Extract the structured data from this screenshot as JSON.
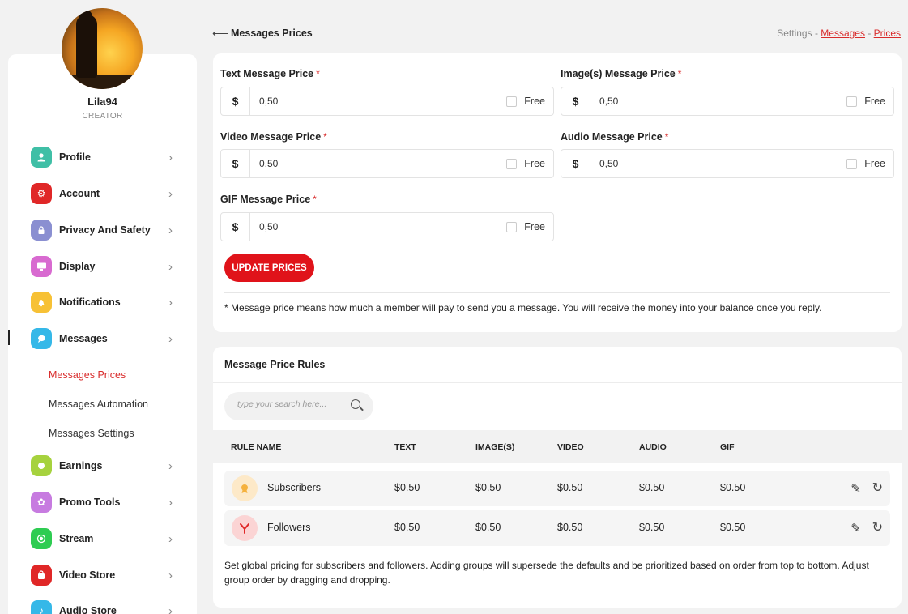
{
  "user": {
    "name": "Lila94",
    "role": "CREATOR"
  },
  "header": {
    "title": "Messages Prices",
    "breadcrumb": {
      "root": "Settings",
      "sep": " - ",
      "middle": "Messages",
      "current": "Prices"
    }
  },
  "sidebar": {
    "items": [
      {
        "label": "Profile",
        "color": "#3fbfa6",
        "icon": "person-icon"
      },
      {
        "label": "Account",
        "color": "#e02727",
        "icon": "gear-icon"
      },
      {
        "label": "Privacy And Safety",
        "color": "#8a8fd1",
        "icon": "lock-icon"
      },
      {
        "label": "Display",
        "color": "#d86ad0",
        "icon": "monitor-icon"
      },
      {
        "label": "Notifications",
        "color": "#f7c135",
        "icon": "bell-icon"
      },
      {
        "label": "Messages",
        "color": "#35b8e8",
        "icon": "chat-icon"
      },
      {
        "label": "Earnings",
        "color": "#a6d23e",
        "icon": "coin-icon"
      },
      {
        "label": "Promo Tools",
        "color": "#c77be0",
        "icon": "sparkle-icon"
      },
      {
        "label": "Stream",
        "color": "#2ecc52",
        "icon": "record-icon"
      },
      {
        "label": "Video Store",
        "color": "#e02727",
        "icon": "bag-icon"
      },
      {
        "label": "Audio Store",
        "color": "#35b8e8",
        "icon": "music-icon"
      }
    ],
    "subitems": [
      {
        "label": "Messages Prices"
      },
      {
        "label": "Messages Automation"
      },
      {
        "label": "Messages Settings"
      }
    ]
  },
  "prices": {
    "fields": [
      {
        "label": "Text Message Price",
        "currency": "$",
        "value": "0,50",
        "free_label": "Free"
      },
      {
        "label": "Image(s) Message Price",
        "currency": "$",
        "value": "0,50",
        "free_label": "Free"
      },
      {
        "label": "Video Message Price",
        "currency": "$",
        "value": "0,50",
        "free_label": "Free"
      },
      {
        "label": "Audio Message Price",
        "currency": "$",
        "value": "0,50",
        "free_label": "Free"
      },
      {
        "label": "GIF Message Price",
        "currency": "$",
        "value": "0,50",
        "free_label": "Free"
      }
    ],
    "required_mark": "*",
    "update_button": "UPDATE PRICES",
    "note": "* Message price means how much a member will pay to send you a message. You will receive the money into your balance once you reply."
  },
  "rules": {
    "title": "Message Price Rules",
    "search_placeholder": "type your search here...",
    "columns": [
      "RULE NAME",
      "TEXT",
      "IMAGE(S)",
      "VIDEO",
      "AUDIO",
      "GIF"
    ],
    "rows": [
      {
        "name": "Subscribers",
        "icon": "badge-icon",
        "icon_bg": "#fde9c8",
        "icon_color": "#f5b13d",
        "values": [
          "$0.50",
          "$0.50",
          "$0.50",
          "$0.50",
          "$0.50"
        ]
      },
      {
        "name": "Followers",
        "icon": "follower-icon",
        "icon_bg": "#fbd4d4",
        "icon_color": "#e02727",
        "values": [
          "$0.50",
          "$0.50",
          "$0.50",
          "$0.50",
          "$0.50"
        ]
      }
    ],
    "footnote": "Set global pricing for subscribers and followers. Adding groups will supersede the defaults and be prioritized based on order from top to bottom. Adjust group order by dragging and dropping."
  }
}
